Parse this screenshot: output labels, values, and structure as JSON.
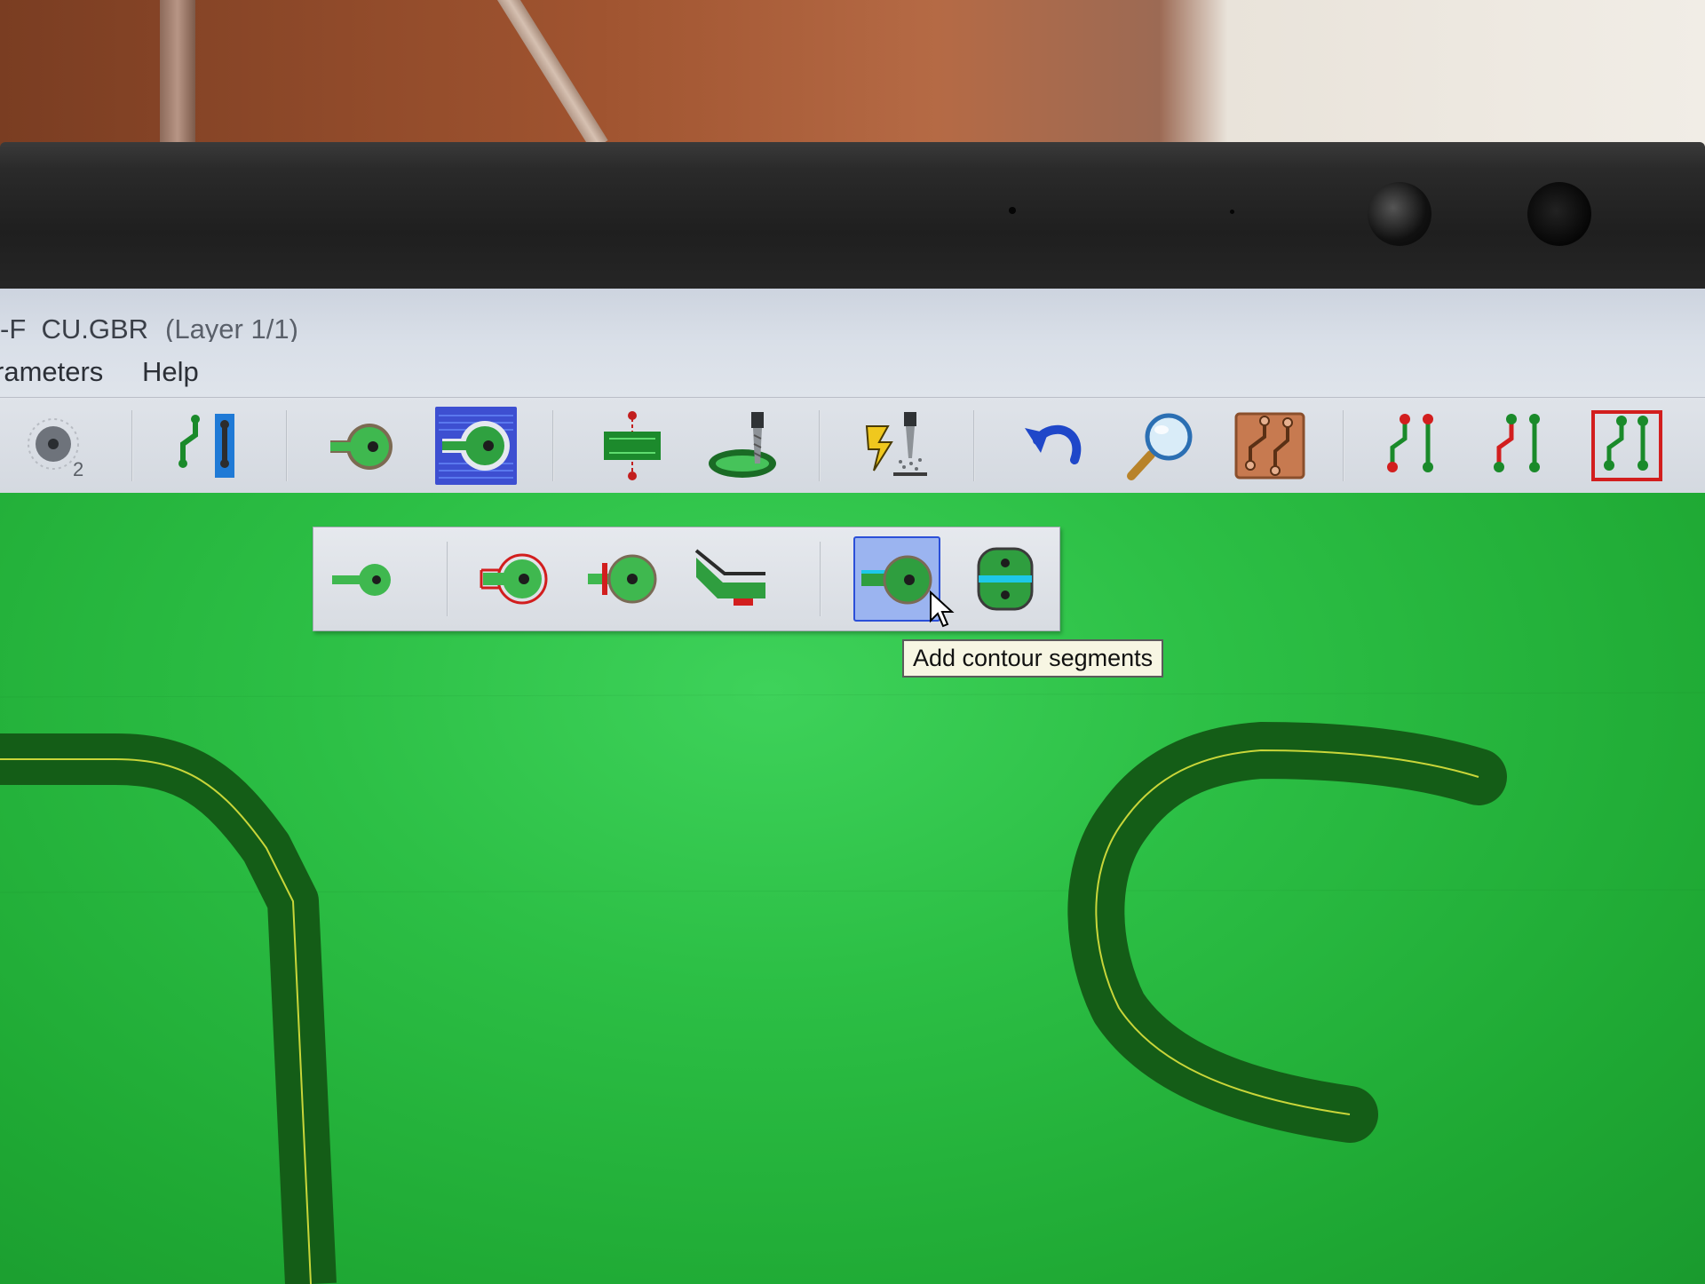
{
  "window": {
    "title_file": "-F_CU.GBR",
    "title_layer": "(Layer 1/1)"
  },
  "menu": {
    "items": [
      "rameters",
      "Help"
    ]
  },
  "toolbar": {
    "buttons": [
      {
        "name": "drill-tool-icon",
        "badge": "2"
      },
      {
        "name": "pcb-trace-blue-icon"
      },
      {
        "name": "pad-isolation-icon"
      },
      {
        "name": "pad-hatch-icon"
      },
      {
        "name": "board-outline-icon"
      },
      {
        "name": "milling-tool-icon"
      },
      {
        "name": "laser-engrave-icon"
      },
      {
        "name": "undo-icon"
      },
      {
        "name": "zoom-icon"
      },
      {
        "name": "copper-board-icon"
      },
      {
        "name": "trace-red-icon"
      },
      {
        "name": "trace-green-red-icon"
      },
      {
        "name": "trace-framed-icon"
      }
    ]
  },
  "flyout": {
    "buttons": [
      {
        "name": "pad-simple-icon"
      },
      {
        "name": "pad-red-contour-icon"
      },
      {
        "name": "pad-red-bar-icon"
      },
      {
        "name": "bend-segment-icon"
      },
      {
        "name": "add-contour-segments-icon",
        "selected": true
      },
      {
        "name": "double-pad-icon"
      }
    ]
  },
  "tooltip": {
    "text": "Add contour segments"
  },
  "colors": {
    "board_green": "#22b33a",
    "trace_dark": "#0f4a12",
    "contour_yellow": "#c9d63a",
    "selection_blue": "#2b4fd8"
  }
}
